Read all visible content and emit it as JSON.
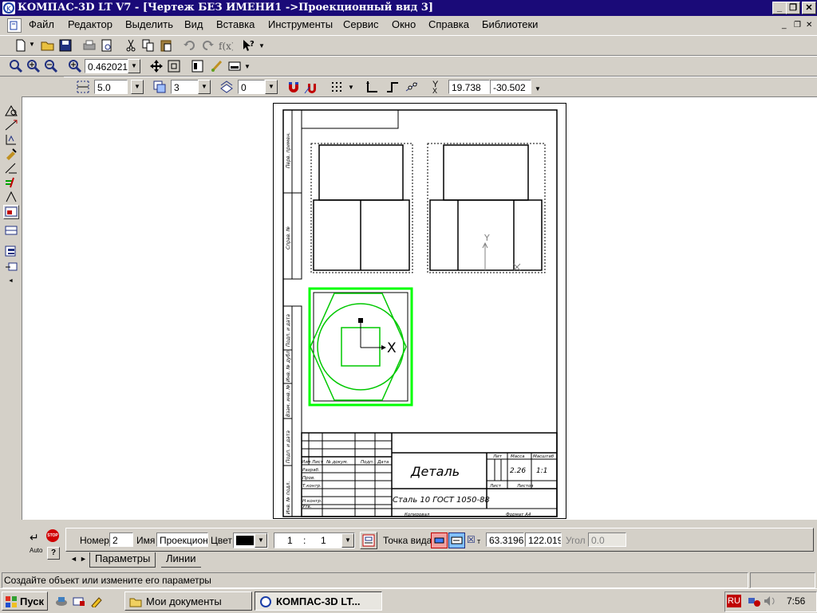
{
  "window": {
    "title": "КОМПАС-3D LT V7 - [Чертеж БЕЗ ИМЕНИ1 ->Проекционный вид 3]"
  },
  "menu": [
    "Файл",
    "Редактор",
    "Выделить",
    "Вид",
    "Вставка",
    "Инструменты",
    "Сервис",
    "Окно",
    "Справка",
    "Библиотеки"
  ],
  "view_toolbar": {
    "zoom": "0.462021"
  },
  "draw_toolbar": {
    "step": "5.0",
    "layer": "3",
    "style": "0",
    "coord_label": "Y",
    "x": "19.738",
    "y": "-30.502"
  },
  "title_block": {
    "name": "Деталь",
    "material": "Сталь 10  ГОСТ 1050-88",
    "mass": "2.26",
    "scale": "1:1",
    "hdr_lit": "Лит",
    "hdr_mass": "Масса",
    "hdr_scale": "Масштаб",
    "hdr_sheet": "Лист",
    "hdr_sheets": "Листов",
    "copied": "Копировал",
    "format": "Формат   А4",
    "col_change": "Изм Лист",
    "col_doc": "№ докум.",
    "col_sign": "Подп.",
    "col_date": "Дата",
    "role_dev": "Разраб.",
    "role_check": "Пров.",
    "role_tcontrol": "Т.контр.",
    "role_ncontrol": "Н.контр.",
    "role_approve": "Утв.",
    "side_labels": [
      "Перв. примен.",
      "Справ. №",
      "Подп. и дата",
      "Инв. № дубл.",
      "Взам. инв. №",
      "Подп. и дата",
      "Инв. № подл."
    ]
  },
  "axis": {
    "x": "X",
    "y": "Y"
  },
  "properties": {
    "number_label": "Номер",
    "number": "2",
    "name_label": "Имя",
    "name": "Проекционн",
    "color_label": "Цвет",
    "color": "#000000",
    "scale_a": "1",
    "scale_sep": ":",
    "scale_b": "1",
    "point_label": "Точка вида",
    "px": "63.3196",
    "py": "122.019",
    "angle_label": "Угол",
    "angle": "0.0",
    "tab_params": "Параметры",
    "tab_lines": "Линии",
    "stop": "STOP",
    "auto": "Auto"
  },
  "status": {
    "message": "Создайте объект или измените его параметры"
  },
  "taskbar": {
    "start": "Пуск",
    "task_docs": "Мои документы",
    "task_kompas": "КОМПАС-3D LT...",
    "lang": "RU",
    "time": "7:56"
  },
  "colors": {
    "titlebar": "#1a0a78",
    "view_green": "#00e000",
    "selected_view": "#00ff00"
  }
}
